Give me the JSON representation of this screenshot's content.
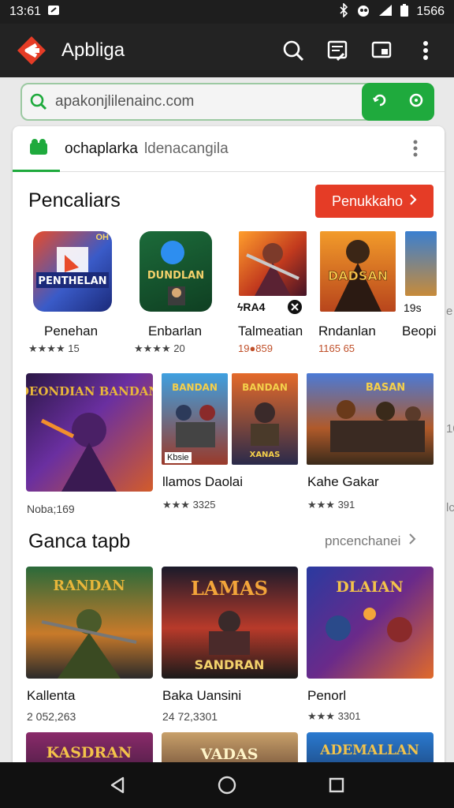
{
  "status": {
    "time": "13:61",
    "battery": "1566"
  },
  "app": {
    "title": "Apbliga"
  },
  "search": {
    "value": "apakonjlilenainc.com"
  },
  "tabs": {
    "active": "ochaplarka",
    "inactive": "ldenacangila"
  },
  "section1": {
    "title": "Pencaliars",
    "button": "Penukkaho",
    "apps": [
      {
        "name": "Penehan",
        "rating": "★★★★ 15",
        "badge": "OH"
      },
      {
        "name": "Enbarlan",
        "rating": "★★★★ 20"
      },
      {
        "name": "Talmeatian",
        "rating": "19●859",
        "badge": "ϟRA4"
      },
      {
        "name": "Rndanlan",
        "rating": "1165 65"
      },
      {
        "name": "Beopi",
        "rating": "",
        "badge": "19s"
      }
    ]
  },
  "section2": {
    "items": [
      {
        "name": "Noba;169"
      },
      {
        "name": "llamos Daolai",
        "rating": "★★★ 3325",
        "inner_label": "Kbsie"
      },
      {
        "name": "Kahe Gakar",
        "rating": "★★★ 391"
      }
    ]
  },
  "section3": {
    "title": "Ganca tapb",
    "more": "pncenchanei",
    "items": [
      {
        "name": "Kallenta",
        "rating": "2 052,263"
      },
      {
        "name": "Baka Uansini",
        "rating": "24 72,3301"
      },
      {
        "name": "Penorl",
        "rating": "★★★ 3301"
      }
    ]
  },
  "art_text": {
    "app1": "PENTHELAN",
    "app2": "DUNDLAN",
    "app4": "DADSAN",
    "big1": "DEONDIAN\nBANDAN",
    "big2": "BANDAN",
    "big3": "BANDAN",
    "big3sub": "XANAS",
    "big4": "BASAN",
    "g1": "RANDAN",
    "g2": "LAMAS",
    "g2sub": "SANDRAN",
    "g3": "DLAIAN",
    "p1": "KASDRAN",
    "p2": "VADAS",
    "p3": "ADEMALLAN"
  },
  "peek": {
    "a": "e",
    "b": "10",
    "c": "lc"
  },
  "colors": {
    "accent_green": "#1faa3d",
    "accent_red": "#e53c26",
    "star": "#e9862c"
  }
}
